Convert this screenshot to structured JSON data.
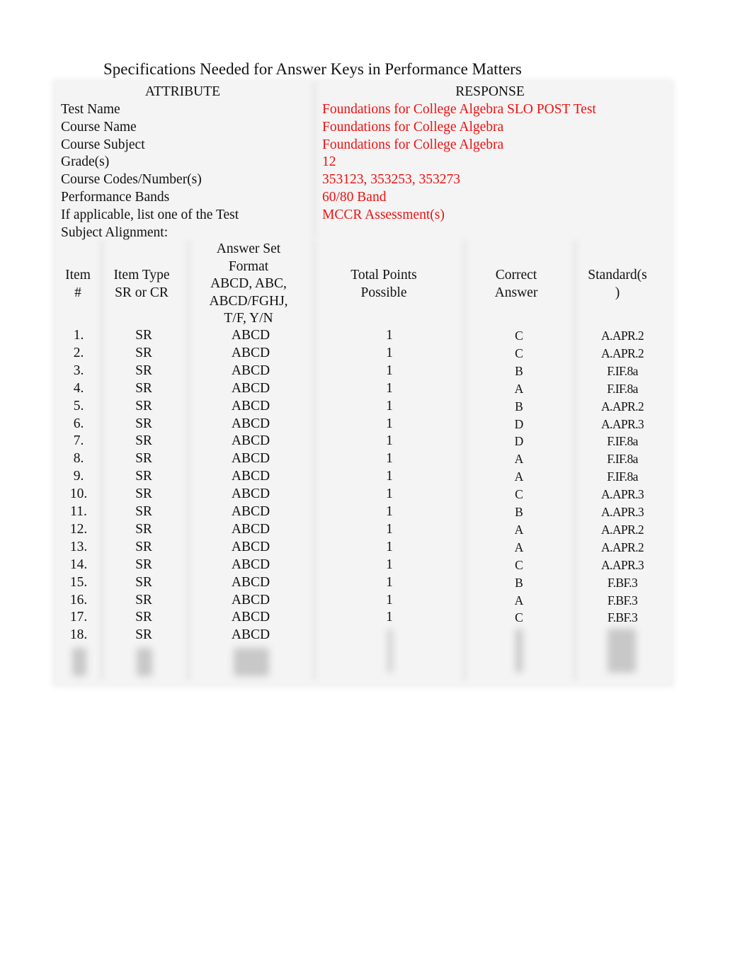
{
  "title": "Specifications Needed for Answer Keys in Performance Matters",
  "attributes": {
    "header": {
      "attribute": "ATTRIBUTE",
      "response": "RESPONSE"
    },
    "rows": [
      {
        "label": "Test Name",
        "value": "Foundations for College Algebra SLO POST Test"
      },
      {
        "label": "Course Name",
        "value": "Foundations for College Algebra"
      },
      {
        "label": "Course Subject",
        "value": "Foundations for College Algebra"
      },
      {
        "label": "Grade(s)",
        "value": "12"
      },
      {
        "label": "Course Codes/Number(s)",
        "value": "353123, 353253, 353273"
      },
      {
        "label": "Performance Bands",
        "value": "60/80 Band"
      },
      {
        "label": "If applicable, list one of the Test",
        "value": "MCCR Assessment(s)"
      },
      {
        "label": "Subject Alignment:",
        "value": ""
      }
    ],
    "response_color": "#ee1111"
  },
  "items": {
    "headers": {
      "item": [
        "Item",
        "#"
      ],
      "type": [
        "Item Type",
        "SR or CR"
      ],
      "format": [
        "Answer Set",
        "Format",
        "ABCD, ABC,",
        "ABCD/FGHJ,",
        "T/F, Y/N"
      ],
      "points": [
        "Total Points",
        "Possible"
      ],
      "answer": [
        "Correct",
        "Answer"
      ],
      "standard": [
        "Standard(s",
        ")"
      ]
    },
    "rows": [
      {
        "item": "1.",
        "type": "SR",
        "format": "ABCD",
        "points": "1",
        "answer": "C",
        "standard": "A.APR.2"
      },
      {
        "item": "2.",
        "type": "SR",
        "format": "ABCD",
        "points": "1",
        "answer": "C",
        "standard": "A.APR.2"
      },
      {
        "item": "3.",
        "type": "SR",
        "format": "ABCD",
        "points": "1",
        "answer": "B",
        "standard": "F.IF.8a"
      },
      {
        "item": "4.",
        "type": "SR",
        "format": "ABCD",
        "points": "1",
        "answer": "A",
        "standard": "F.IF.8a"
      },
      {
        "item": "5.",
        "type": "SR",
        "format": "ABCD",
        "points": "1",
        "answer": "B",
        "standard": "A.APR.2"
      },
      {
        "item": "6.",
        "type": "SR",
        "format": "ABCD",
        "points": "1",
        "answer": "D",
        "standard": "A.APR.3"
      },
      {
        "item": "7.",
        "type": "SR",
        "format": "ABCD",
        "points": "1",
        "answer": "D",
        "standard": "F.IF.8a"
      },
      {
        "item": "8.",
        "type": "SR",
        "format": "ABCD",
        "points": "1",
        "answer": "A",
        "standard": "F.IF.8a"
      },
      {
        "item": "9.",
        "type": "SR",
        "format": "ABCD",
        "points": "1",
        "answer": "A",
        "standard": "F.IF.8a"
      },
      {
        "item": "10.",
        "type": "SR",
        "format": "ABCD",
        "points": "1",
        "answer": "C",
        "standard": "A.APR.3"
      },
      {
        "item": "11.",
        "type": "SR",
        "format": "ABCD",
        "points": "1",
        "answer": "B",
        "standard": "A.APR.3"
      },
      {
        "item": "12.",
        "type": "SR",
        "format": "ABCD",
        "points": "1",
        "answer": "A",
        "standard": "A.APR.2"
      },
      {
        "item": "13.",
        "type": "SR",
        "format": "ABCD",
        "points": "1",
        "answer": "A",
        "standard": "A.APR.2"
      },
      {
        "item": "14.",
        "type": "SR",
        "format": "ABCD",
        "points": "1",
        "answer": "C",
        "standard": "A.APR.3"
      },
      {
        "item": "15.",
        "type": "SR",
        "format": "ABCD",
        "points": "1",
        "answer": "B",
        "standard": "F.BF.3"
      },
      {
        "item": "16.",
        "type": "SR",
        "format": "ABCD",
        "points": "1",
        "answer": "A",
        "standard": "F.BF.3"
      },
      {
        "item": "17.",
        "type": "SR",
        "format": "ABCD",
        "points": "1",
        "answer": "C",
        "standard": "F.BF.3"
      },
      {
        "item": "18.",
        "type": "SR",
        "format": "ABCD",
        "points": "",
        "answer": "",
        "standard": ""
      }
    ]
  }
}
